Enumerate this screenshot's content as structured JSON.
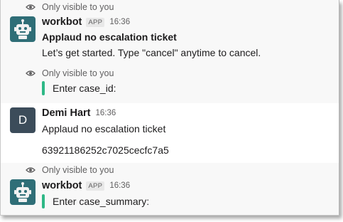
{
  "visibility_notice": "Only visible to you",
  "messages": [
    {
      "author": "workbot",
      "badge": "APP",
      "time": "16:36",
      "title": "Applaud no escalation ticket",
      "text": "Let’s get started. Type \"cancel\" anytime to cancel."
    },
    {
      "prompt": "Enter case_id:"
    },
    {
      "author": "Demi Hart",
      "avatar_letter": "D",
      "time": "16:36",
      "title": "Applaud no escalation ticket",
      "text": "63921186252c7025cecfc7a5"
    },
    {
      "author": "workbot",
      "badge": "APP",
      "time": "16:36",
      "prompt": "Enter case_summary:"
    }
  ],
  "colors": {
    "attachment_bar": "#2eb886",
    "bot_avatar": "#2f6e77",
    "user_avatar": "#3c4c5a"
  },
  "icons": {
    "visibility": "eye-icon",
    "bot_avatar": "robot-icon"
  }
}
